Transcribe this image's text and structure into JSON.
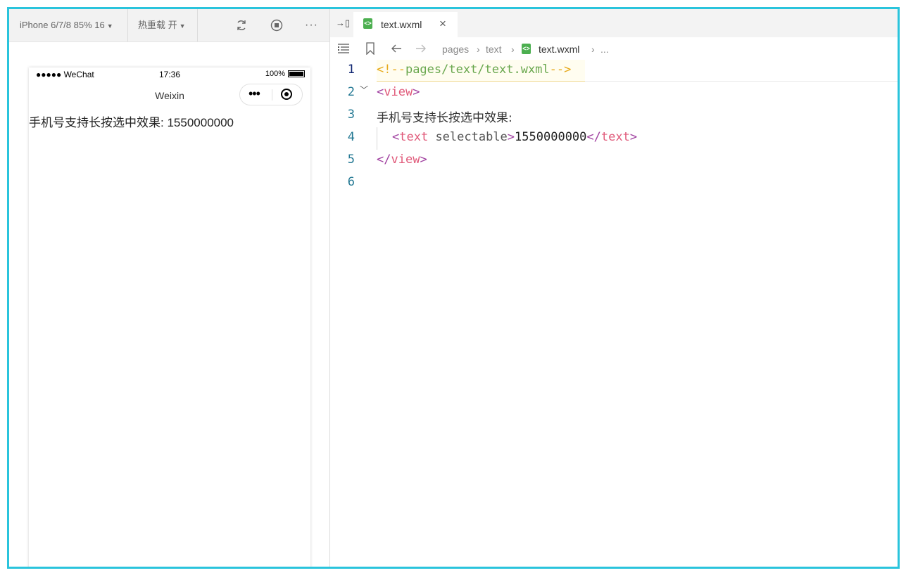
{
  "simulator": {
    "toolbar": {
      "device": "iPhone 6/7/8 85% 16",
      "hot_reload": "热重载 开",
      "more": "···"
    },
    "status_bar": {
      "signal": "●●●●● WeChat",
      "time": "17:36",
      "battery": "100%"
    },
    "nav": {
      "title": "Weixin"
    },
    "page": {
      "label": "手机号支持长按选中效果:",
      "value": "1550000000"
    }
  },
  "editor": {
    "tab": {
      "label": "text.wxml",
      "close": "×"
    },
    "breadcrumb": [
      "pages",
      "text",
      "text.wxml",
      "..."
    ],
    "lines": [
      {
        "num": "1",
        "comment_open": "<!--",
        "comment_body": "pages/text/text.wxml",
        "comment_close": "-->"
      },
      {
        "num": "2",
        "open": "<",
        "tag": "view",
        "close": ">"
      },
      {
        "num": "3",
        "text": "手机号支持长按选中效果:"
      },
      {
        "num": "4",
        "open": "<",
        "tag": "text",
        "attr": " selectable",
        "close": ">",
        "value": "1550000000",
        "end_open": "</",
        "end_tag": "text",
        "end_close": ">"
      },
      {
        "num": "5",
        "open": "</",
        "tag": "view",
        "close": ">"
      },
      {
        "num": "6"
      }
    ]
  },
  "colors": {
    "frame_border": "#2ac4dc",
    "file_icon": "#4caf50",
    "tag": "#e05a7a",
    "comment": "#e6a817"
  }
}
